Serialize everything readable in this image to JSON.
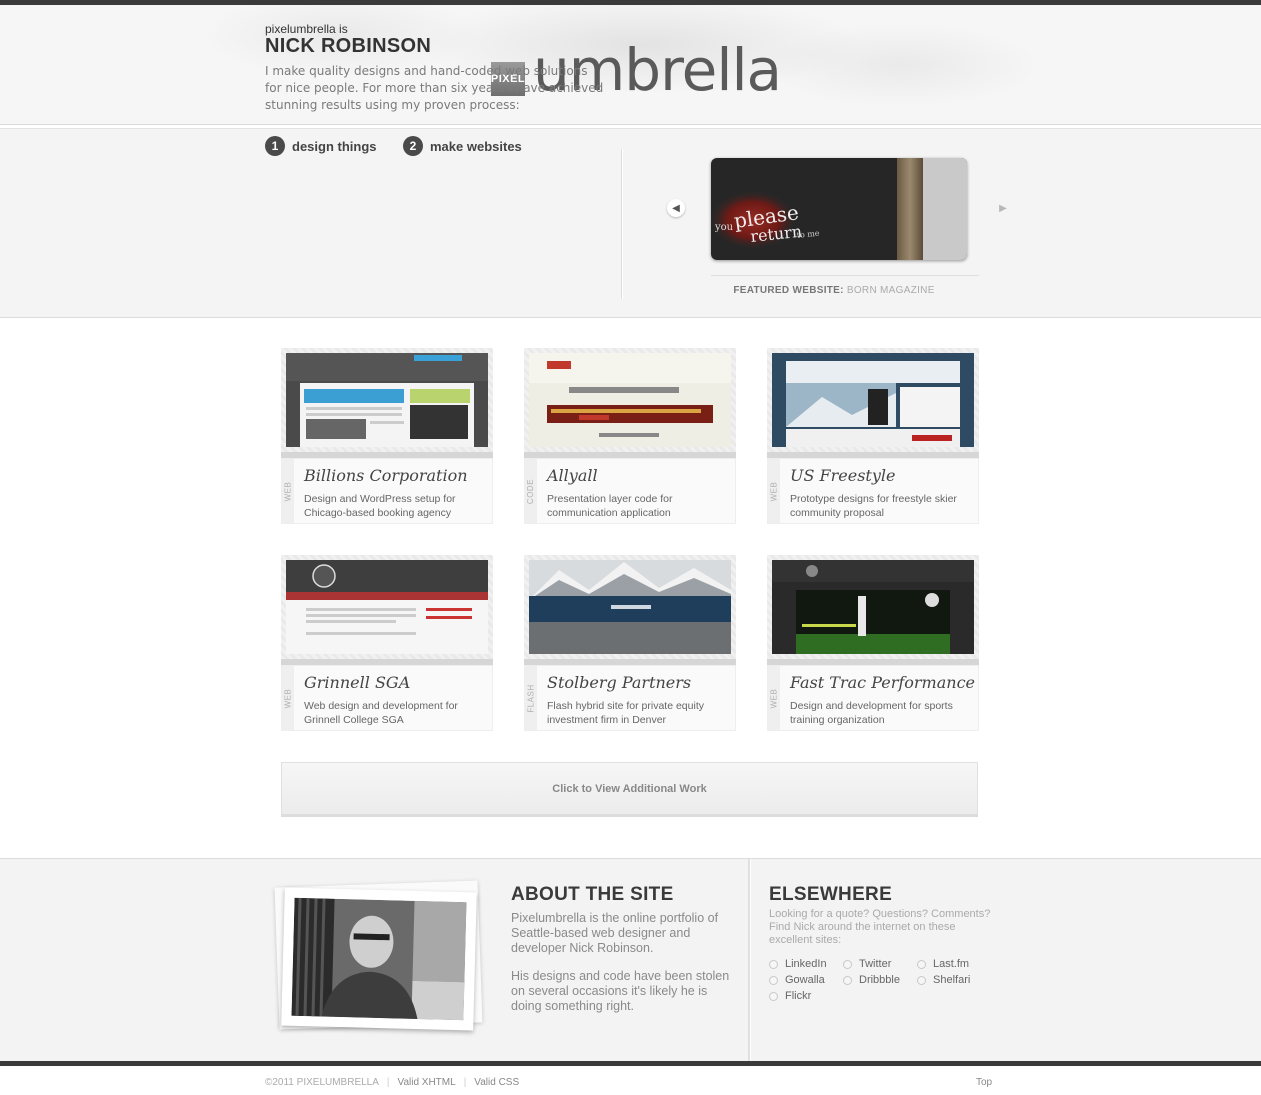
{
  "header": {
    "logo_badge": "PIXEL",
    "logo_text": "umbrella"
  },
  "intro": {
    "kicker": "pixelumbrella is",
    "name": "NICK ROBINSON",
    "text": "I make quality designs and hand-coded web solutions for nice people. For more than six years I have achieved stunning results using my proven process:",
    "steps": [
      {
        "num": "1",
        "label": "design things"
      },
      {
        "num": "2",
        "label": "make websites"
      }
    ]
  },
  "featured": {
    "image_text_1": "you",
    "image_text_2": "please",
    "image_text_3": "return",
    "image_text_4": "to me",
    "prev_glyph": "◀",
    "next_glyph": "▶",
    "caption_key": "FEATURED WEBSITE:",
    "caption_value": "BORN MAGAZINE"
  },
  "portfolio": [
    {
      "tag": "WEB",
      "title": "Billions Corporation",
      "desc": "Design and WordPress setup for Chicago-based booking agency"
    },
    {
      "tag": "CODE",
      "title": "Allyall",
      "desc": "Presentation layer code for communication application"
    },
    {
      "tag": "WEB",
      "title": "US Freestyle",
      "desc": "Prototype designs for freestyle skier community proposal"
    },
    {
      "tag": "WEB",
      "title": "Grinnell SGA",
      "desc": "Web design and development for Grinnell College SGA"
    },
    {
      "tag": "FLASH",
      "title": "Stolberg Partners",
      "desc": "Flash hybrid site for private equity investment firm in Denver"
    },
    {
      "tag": "WEB",
      "title": "Fast Trac Performance",
      "desc": "Design and development for sports training organization"
    }
  ],
  "more_button": "Click to View Additional Work",
  "about": {
    "heading": "ABOUT THE SITE",
    "p1": "Pixelumbrella is the online portfolio of Seattle-based web designer and developer Nick Robinson.",
    "p2": "His designs and code have been stolen on several occasions it's likely he is doing something right."
  },
  "elsewhere": {
    "heading": "ELSEWHERE",
    "text": "Looking for a quote? Questions? Comments? Find Nick around the internet on these excellent sites:",
    "links": [
      "LinkedIn",
      "Twitter",
      "Last.fm",
      "Gowalla",
      "Dribbble",
      "Shelfari",
      "Flickr"
    ]
  },
  "legal": {
    "copyright": "©2011 PIXELUMBRELLA",
    "sep": "|",
    "xhtml": "Valid XHTML",
    "css": "Valid CSS",
    "top": "Top"
  }
}
